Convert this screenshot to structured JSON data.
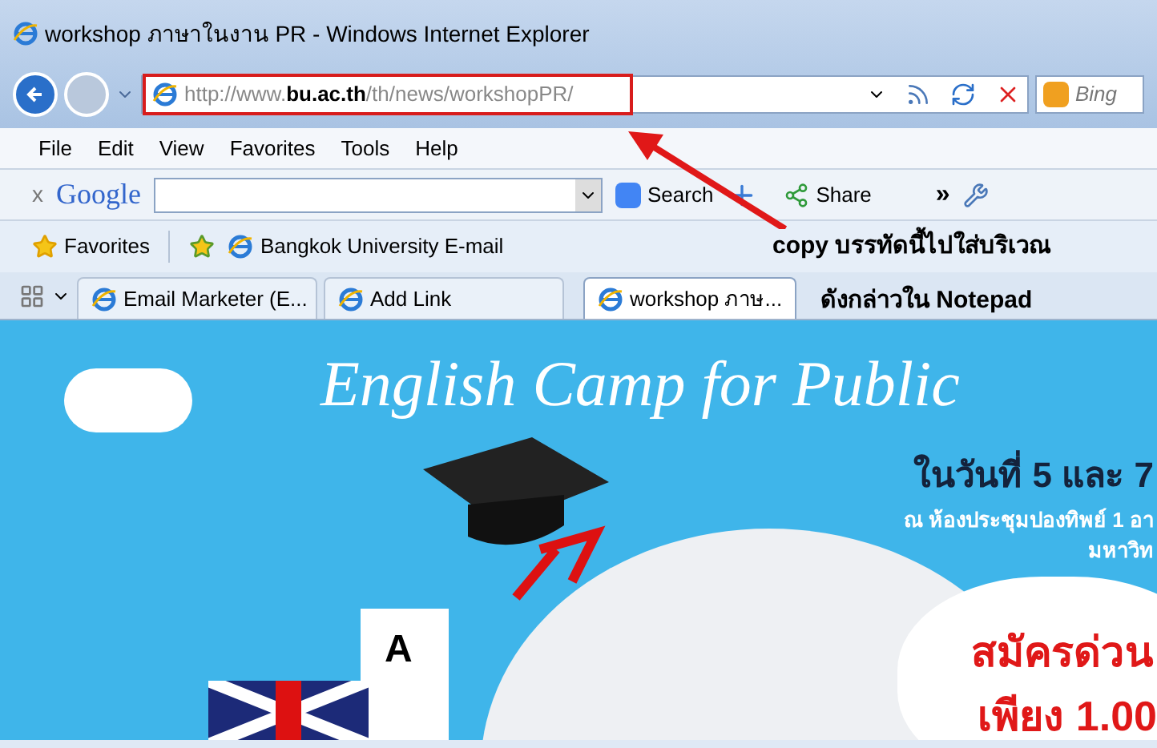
{
  "window": {
    "title": "workshop ภาษาในงาน PR - Windows Internet Explorer"
  },
  "address_bar": {
    "url": "http://www.**bu.ac.th**/th/news/workshopPR/"
  },
  "search_box": {
    "placeholder": "Bing"
  },
  "menu": [
    "File",
    "Edit",
    "View",
    "Favorites",
    "Tools",
    "Help"
  ],
  "google_toolbar": {
    "close": "x",
    "logo": "Google",
    "search": "Search",
    "share": "Share",
    "more": "»"
  },
  "favorites_bar": {
    "label": "Favorites",
    "links": [
      "Bangkok University E-mail"
    ]
  },
  "tabs": [
    {
      "label": "Email Marketer (E...",
      "selected": false
    },
    {
      "label": "Add Link",
      "selected": false
    },
    {
      "label": "workshop ภาษ...",
      "selected": true
    }
  ],
  "annotation": {
    "lines": [
      "copy บรรทัดนี้ไปใส่บริเวณ",
      "ดังกล่าวใน Notepad"
    ]
  },
  "banner": {
    "title": "English Camp for Public",
    "date": "ในวันที่ 5 และ 7",
    "venue": "ณ ห้องประชุมปองทิพย์ 1 อา",
    "venue_2": "มหาวิท",
    "letter": "A",
    "cta": "สมัครด่วน",
    "price": "เพียง 1.00"
  }
}
